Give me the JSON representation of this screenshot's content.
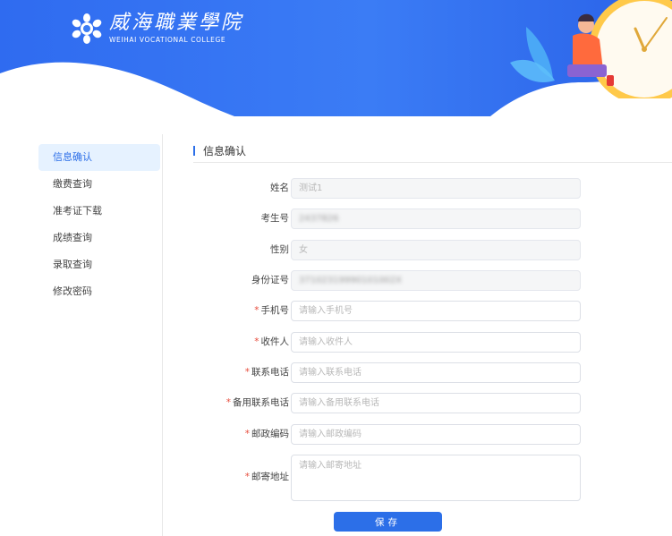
{
  "header": {
    "school_name_cn": "威海職業學院",
    "school_name_en": "WEIHAI VOCATIONAL COLLEGE"
  },
  "sidebar": {
    "items": [
      {
        "label": "信息确认",
        "active": true
      },
      {
        "label": "缴费查询",
        "active": false
      },
      {
        "label": "准考证下载",
        "active": false
      },
      {
        "label": "成绩查询",
        "active": false
      },
      {
        "label": "录取查询",
        "active": false
      },
      {
        "label": "修改密码",
        "active": false
      }
    ]
  },
  "section": {
    "title": "信息确认"
  },
  "form": {
    "required_mark": "*",
    "name": {
      "label": "姓名",
      "value": "测试1"
    },
    "exam_no": {
      "label": "考生号",
      "value": "2437826"
    },
    "gender": {
      "label": "性别",
      "value": "女"
    },
    "id_card": {
      "label": "身份证号",
      "value": "37102319990101002X"
    },
    "phone": {
      "label": "手机号",
      "placeholder": "请输入手机号"
    },
    "recipient": {
      "label": "收件人",
      "placeholder": "请输入收件人"
    },
    "contact_phone": {
      "label": "联系电话",
      "placeholder": "请输入联系电话"
    },
    "backup_phone": {
      "label": "备用联系电话",
      "placeholder": "请输入备用联系电话"
    },
    "postcode": {
      "label": "邮政编码",
      "placeholder": "请输入邮政编码"
    },
    "address": {
      "label": "邮寄地址",
      "placeholder": "请输入邮寄地址"
    },
    "save_label": "保存"
  },
  "colors": {
    "primary": "#2c6fe8",
    "banner": "#3b7cf5",
    "required": "#e74c3c",
    "active_bg": "#e6f2ff"
  }
}
